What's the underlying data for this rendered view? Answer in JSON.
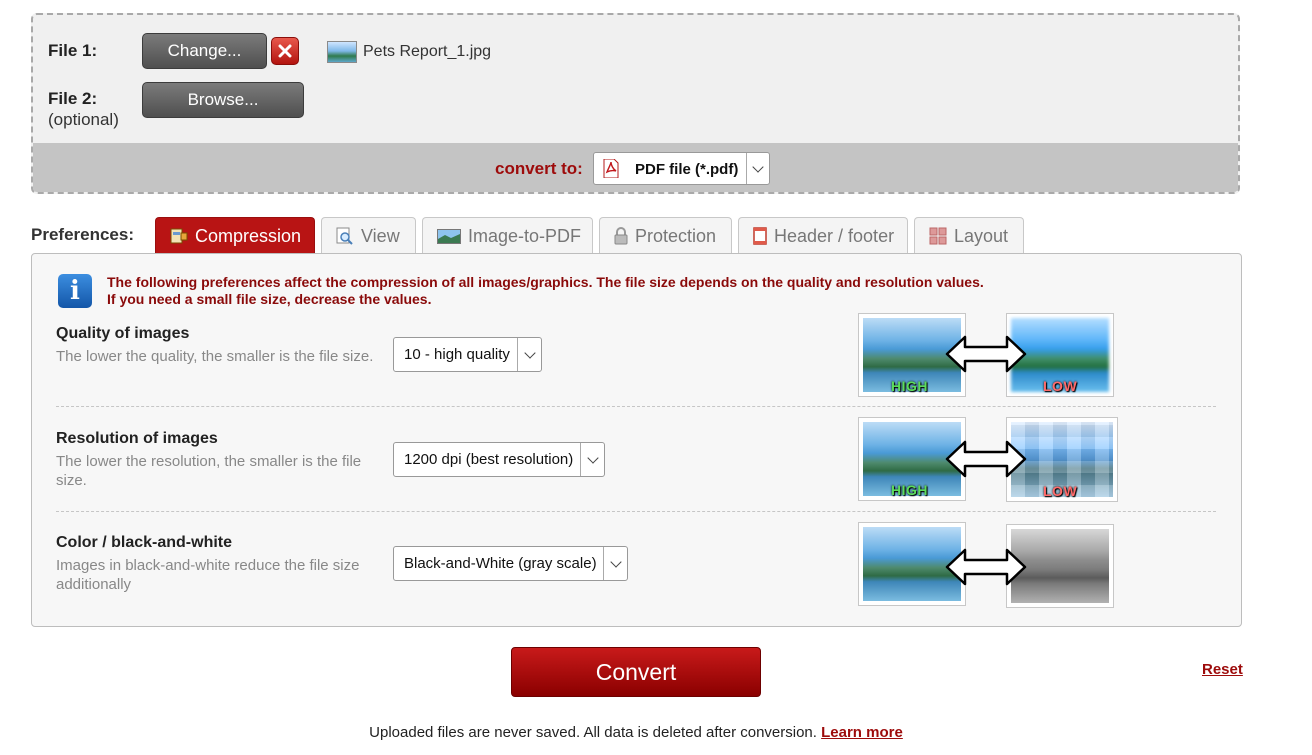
{
  "upload": {
    "file1_label": "File 1:",
    "change_label": "Change...",
    "file1_name": "Pets Report_1.jpg",
    "file2_label": "File 2:",
    "file2_sub": "(optional)",
    "browse_label": "Browse..."
  },
  "convert": {
    "label": "convert to:",
    "value": "PDF file (*.pdf)"
  },
  "preferences": {
    "label": "Preferences:",
    "tabs": [
      {
        "label": "Compression",
        "icon": "compression-icon",
        "active": true
      },
      {
        "label": "View",
        "icon": "magnifier-icon",
        "active": false
      },
      {
        "label": "Image-to-PDF",
        "icon": "image-icon",
        "active": false
      },
      {
        "label": "Protection",
        "icon": "lock-icon",
        "active": false
      },
      {
        "label": "Header / footer",
        "icon": "page-icon",
        "active": false
      },
      {
        "label": "Layout",
        "icon": "layout-icon",
        "active": false
      }
    ]
  },
  "panel": {
    "info_line1": "The following preferences affect the compression of all images/graphics. The file size depends on the quality and resolution values.",
    "info_line2": "If you need a small file size, decrease the values.",
    "rows": [
      {
        "title": "Quality of images",
        "desc": "The lower the quality, the smaller is the file size.",
        "value": "10 - high quality",
        "left_badge": "HIGH",
        "right_badge": "LOW"
      },
      {
        "title": "Resolution of images",
        "desc": "The lower the resolution, the smaller is the file size.",
        "value": "1200 dpi (best resolution)",
        "left_badge": "HIGH",
        "right_badge": "LOW"
      },
      {
        "title": "Color / black-and-white",
        "desc": "Images in black-and-white reduce the file size additionally",
        "value": "Black-and-White (gray scale)"
      }
    ]
  },
  "actions": {
    "convert_label": "Convert",
    "reset_label": "Reset"
  },
  "footer": {
    "note": "Uploaded files are never saved. All data is deleted after conversion.",
    "learn_more": "Learn more"
  },
  "colors": {
    "accent": "#b81414",
    "dark_red_text": "#9d0b0b"
  }
}
